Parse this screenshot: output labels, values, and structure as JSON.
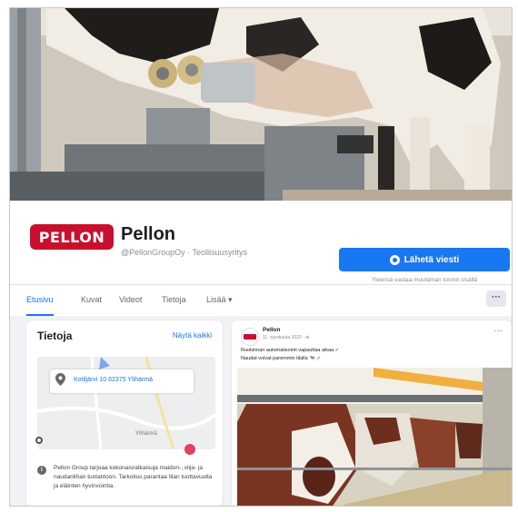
{
  "page": {
    "logo_text": "PELLON",
    "name": "Pellon",
    "subtitle": "@PellonGroupOy · Teollisuusyritys",
    "send_message_label": "Lähetä viesti",
    "reply_note": "Yleensä vastaa muutaman tunnin sisällä"
  },
  "nav": {
    "tabs": [
      "Etusivu",
      "Kuvat",
      "Videot",
      "Tietoja",
      "Lisää ▾"
    ],
    "more_button": "···"
  },
  "about": {
    "title": "Tietoja",
    "see_all": "Näytä kaikki",
    "address": "Kotiljärvi 10 62375 Ylihärmä",
    "map_label": "Ylihärmä",
    "description": "Pellon Group tarjoaa kokonaisratkaisuja maidon-, vilja- ja naudanlihan tuotantoon. Tarkoitus parantaa tilan tuottavuutta ja eläinten hyvinvointia."
  },
  "post": {
    "author": "Pellon",
    "time": "11. syyskuuta 2020 · ⊕",
    "text_line1": "Ruokinnan automatisointi vapauttaa aikaa ✓",
    "text_line2": "Naudat voivat paremmin tilalla 🐄 ✓",
    "menu": "···"
  },
  "colors": {
    "brand_red": "#c8102e",
    "facebook_blue": "#1877f2",
    "background": "#f0f2f5"
  },
  "icons": [
    "message-icon",
    "location-pin-icon",
    "info-icon",
    "more-options-icon",
    "globe-icon"
  ]
}
